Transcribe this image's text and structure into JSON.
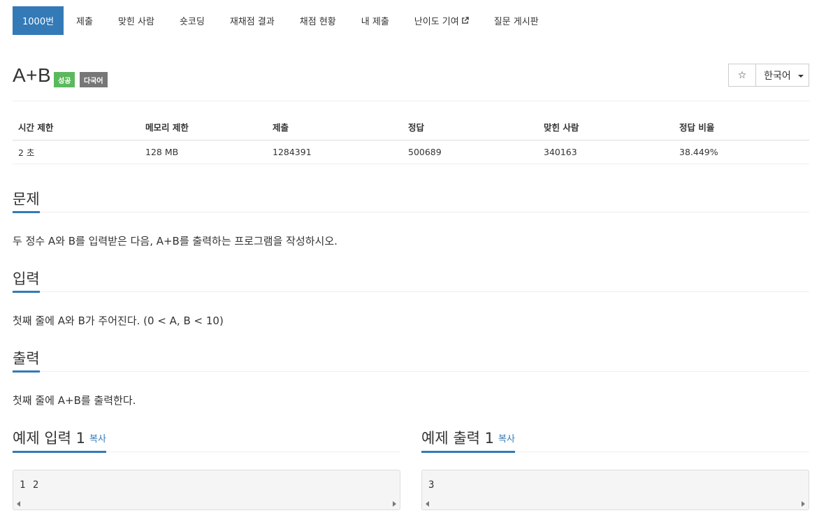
{
  "nav": {
    "items": [
      "1000번",
      "제출",
      "맞힌 사람",
      "숏코딩",
      "재채점 결과",
      "채점 현황",
      "내 제출",
      "난이도 기여",
      "질문 게시판"
    ]
  },
  "problem": {
    "title": "A+B",
    "badges": {
      "success": "성공",
      "multilang": "다국어"
    },
    "star_symbol": "☆",
    "language": "한국어"
  },
  "info": {
    "headers": [
      "시간 제한",
      "메모리 제한",
      "제출",
      "정답",
      "맞힌 사람",
      "정답 비율"
    ],
    "values": [
      "2 초",
      "128 MB",
      "1284391",
      "500689",
      "340163",
      "38.449%"
    ]
  },
  "sections": {
    "description": {
      "heading": "문제",
      "text": "두 정수 A와 B를 입력받은 다음, A+B를 출력하는 프로그램을 작성하시오."
    },
    "input": {
      "heading": "입력",
      "text": "첫째 줄에 A와 B가 주어진다. (0 < A, B < 10)"
    },
    "output": {
      "heading": "출력",
      "text": "첫째 줄에 A+B를 출력한다."
    }
  },
  "samples": {
    "input": {
      "heading": "예제 입력 1",
      "copy": "복사",
      "content": "1 2"
    },
    "output": {
      "heading": "예제 출력 1",
      "copy": "복사",
      "content": "3"
    }
  },
  "colors": {
    "accent": "#337ab7",
    "success": "#5cb85c",
    "muted": "#777777"
  }
}
